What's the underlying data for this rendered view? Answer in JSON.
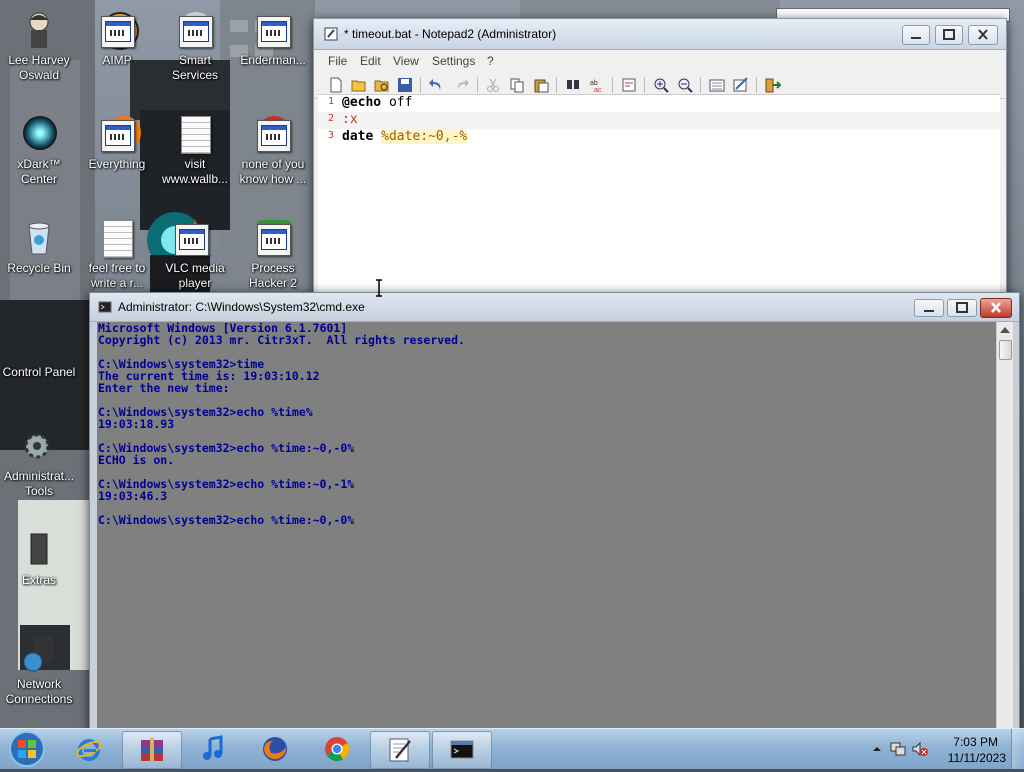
{
  "desktop": {
    "icons": [
      {
        "label": "Lee Harvey Oswald"
      },
      {
        "label": "AIMP"
      },
      {
        "label": "Smart Services"
      },
      {
        "label": "Enderman..."
      },
      {
        "label": "xDark™ Center"
      },
      {
        "label": "Everything"
      },
      {
        "label": "visit www.wallb..."
      },
      {
        "label": "none of you know how ..."
      },
      {
        "label": "Recycle Bin"
      },
      {
        "label": "feel free to write a r..."
      },
      {
        "label": "VLC media player"
      },
      {
        "label": "Process Hacker 2"
      },
      {
        "label": "Control Panel"
      },
      {
        "label": "Administrat... Tools"
      },
      {
        "label": "Extras"
      },
      {
        "label": "Network Connections"
      }
    ]
  },
  "notepad": {
    "title": "* timeout.bat - Notepad2 (Administrator)",
    "menu": [
      "File",
      "Edit",
      "View",
      "Settings",
      "?"
    ],
    "lines": [
      {
        "num": "1",
        "kw": "@echo",
        "rest": " off"
      },
      {
        "num": "2",
        "label": ":x"
      },
      {
        "num": "3",
        "kw": "date",
        "sp": " ",
        "var": "%date:~0,-%"
      }
    ]
  },
  "cmd": {
    "title": "Administrator: C:\\Windows\\System32\\cmd.exe",
    "lines": [
      "Microsoft Windows [Version 6.1.7601]",
      "Copyright (c) 2013 mr. Citr3xT.  All rights reserved.",
      "",
      "C:\\Windows\\system32>time",
      "The current time is: 19:03:10.12",
      "Enter the new time:",
      "",
      "C:\\Windows\\system32>echo %time%",
      "19:03:18.93",
      "",
      "C:\\Windows\\system32>echo %time:~0,-0%",
      "ECHO is on.",
      "",
      "C:\\Windows\\system32>echo %time:~0,-1%",
      "19:03:46.3",
      "",
      "C:\\Windows\\system32>echo %time:~0,-0%"
    ]
  },
  "taskbar": {
    "clock_time": "7:03 PM",
    "clock_date": "11/11/2023",
    "pinned": [
      "winrar-icon",
      "internet-explorer-icon",
      "itunes-icon",
      "firefox-icon",
      "chrome-icon",
      "notepad2-icon",
      "cmd-icon"
    ]
  }
}
